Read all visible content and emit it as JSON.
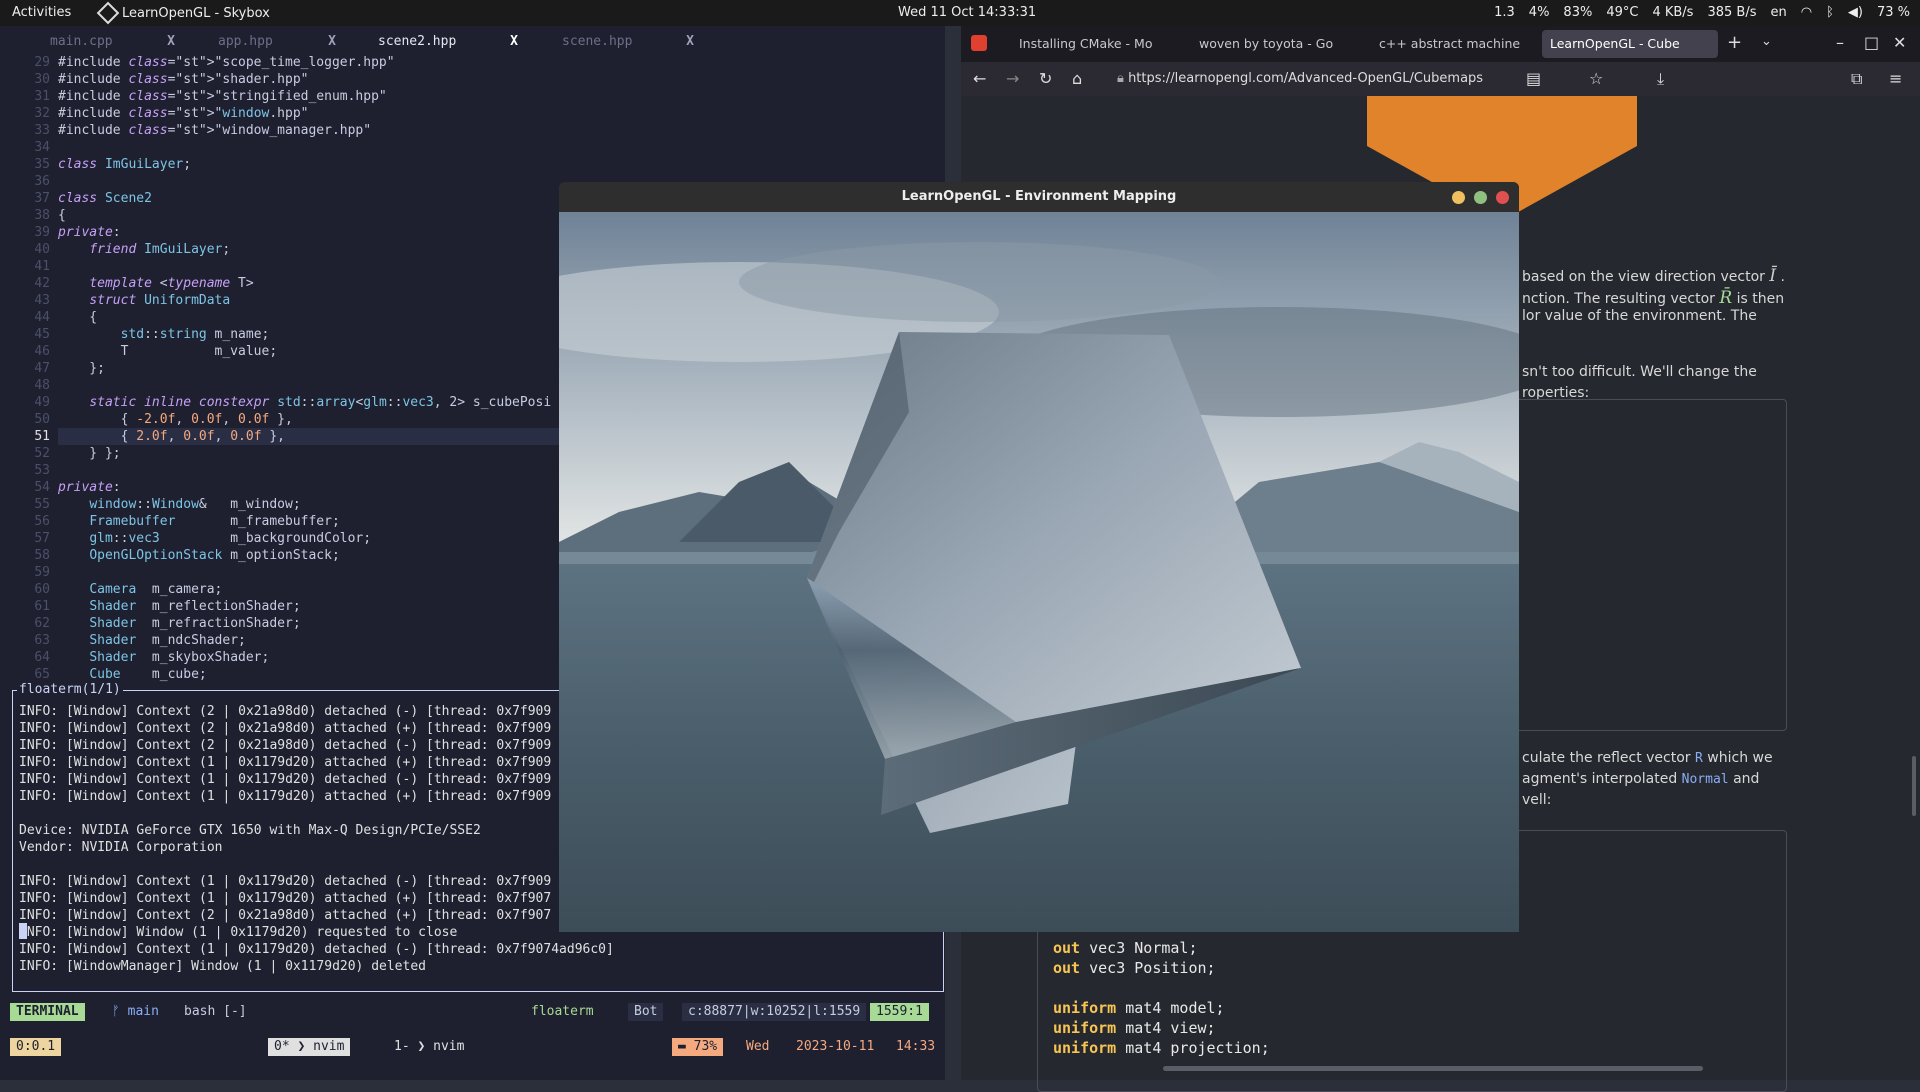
{
  "topbar": {
    "activities": "Activities",
    "window_title": "LearnOpenGL - Skybox",
    "clock": "Wed 11 Oct  14:33:31",
    "stats": [
      "1.3",
      "4%",
      "83%",
      "49°C",
      "4 KB/s",
      "385 B/s",
      "en",
      "73 %"
    ]
  },
  "editor": {
    "tabs": [
      {
        "label": "main.cpp",
        "close": "X"
      },
      {
        "label": "app.hpp",
        "close": "X"
      },
      {
        "label": "scene2.hpp",
        "close": "X"
      },
      {
        "label": "scene.hpp",
        "close": "X"
      }
    ],
    "lines": [
      {
        "n": "29",
        "t": "#include \"scope_time_logger.hpp\""
      },
      {
        "n": "30",
        "t": "#include \"shader.hpp\""
      },
      {
        "n": "31",
        "t": "#include \"stringified_enum.hpp\""
      },
      {
        "n": "32",
        "t": "#include \"window.hpp\""
      },
      {
        "n": "33",
        "t": "#include \"window_manager.hpp\""
      },
      {
        "n": "34",
        "t": ""
      },
      {
        "n": "35",
        "t": "class ImGuiLayer;"
      },
      {
        "n": "36",
        "t": ""
      },
      {
        "n": "37",
        "t": "class Scene2"
      },
      {
        "n": "38",
        "t": "{"
      },
      {
        "n": "39",
        "t": "private:"
      },
      {
        "n": "40",
        "t": "    friend ImGuiLayer;"
      },
      {
        "n": "41",
        "t": ""
      },
      {
        "n": "42",
        "t": "    template <typename T>"
      },
      {
        "n": "43",
        "t": "    struct UniformData"
      },
      {
        "n": "44",
        "t": "    {"
      },
      {
        "n": "45",
        "t": "        std::string m_name;"
      },
      {
        "n": "46",
        "t": "        T           m_value;"
      },
      {
        "n": "47",
        "t": "    };"
      },
      {
        "n": "48",
        "t": ""
      },
      {
        "n": "49",
        "t": "    static inline constexpr std::array<glm::vec3, 2> s_cubePosi"
      },
      {
        "n": "50",
        "t": "        { -2.0f, 0.0f, 0.0f },"
      },
      {
        "n": "51",
        "t": "        { 2.0f, 0.0f, 0.0f },"
      },
      {
        "n": "52",
        "t": "    } };"
      },
      {
        "n": "53",
        "t": ""
      },
      {
        "n": "54",
        "t": "private:"
      },
      {
        "n": "55",
        "t": "    window::Window&   m_window;"
      },
      {
        "n": "56",
        "t": "    Framebuffer       m_framebuffer;"
      },
      {
        "n": "57",
        "t": "    glm::vec3         m_backgroundColor;"
      },
      {
        "n": "58",
        "t": "    OpenGLOptionStack m_optionStack;"
      },
      {
        "n": "59",
        "t": ""
      },
      {
        "n": "60",
        "t": "    Camera  m_camera;"
      },
      {
        "n": "61",
        "t": "    Shader  m_reflectionShader;"
      },
      {
        "n": "62",
        "t": "    Shader  m_refractionShader;"
      },
      {
        "n": "63",
        "t": "    Shader  m_ndcShader;"
      },
      {
        "n": "64",
        "t": "    Shader  m_skyboxShader;"
      },
      {
        "n": "65",
        "t": "    Cube    m_cube;"
      }
    ],
    "floaterm_title": "floaterm(1/1)",
    "terminal": [
      "INFO: [Window] Context (2 | 0x21a98d0) detached (-) [thread: 0x7f909",
      "INFO: [Window] Context (2 | 0x21a98d0) attached (+) [thread: 0x7f909",
      "INFO: [Window] Context (2 | 0x21a98d0) detached (-) [thread: 0x7f909",
      "INFO: [Window] Context (1 | 0x1179d20) attached (+) [thread: 0x7f909",
      "INFO: [Window] Context (1 | 0x1179d20) detached (-) [thread: 0x7f909",
      "INFO: [Window] Context (1 | 0x1179d20) attached (+) [thread: 0x7f909",
      "",
      "Device: NVIDIA GeForce GTX 1650 with Max-Q Design/PCIe/SSE2",
      "Vendor: NVIDIA Corporation",
      "",
      "INFO: [Window] Context (1 | 0x1179d20) detached (-) [thread: 0x7f909",
      "INFO: [Window] Context (1 | 0x1179d20) attached (+) [thread: 0x7f907",
      "INFO: [Window] Context (2 | 0x21a98d0) attached (+) [thread: 0x7f907",
      "INFO: [Window] Window (1 | 0x1179d20) requested to close",
      "INFO: [Window] Context (1 | 0x1179d20) detached (-) [thread: 0x7f9074ad96c0]",
      "INFO: [WindowManager] Window (1 | 0x1179d20) deleted"
    ],
    "status1": {
      "mode": "TERMINAL",
      "branch": "main",
      "shell": "bash [-]",
      "plugin": "floaterm",
      "pos": "Bot",
      "info": "c:88877|w:10252|l:1559",
      "line": "1559:1"
    },
    "status2": {
      "session": "0:0.1",
      "win1": "0*",
      "win1_name": "nvim",
      "win2": "1-",
      "win2_name": "nvim",
      "battery": "73%",
      "day": "Wed",
      "date": "2023-10-11",
      "time": "14:33"
    }
  },
  "browser": {
    "tabs": [
      {
        "label": "Installing CMake - Mo"
      },
      {
        "label": "woven by toyota - Go"
      },
      {
        "label": "c++ abstract machine"
      },
      {
        "label": "LearnOpenGL - Cube"
      }
    ],
    "url": "https://learnopengl.com/Advanced-OpenGL/Cubemaps",
    "page_text": [
      "based on the view direction vector",
      "nction. The resulting vector",
      "is then",
      "lor value of the environment. The",
      "sn't too difficult. We'll change the",
      "roperties:",
      "culate the reflect vector",
      "which we",
      "agment's interpolated",
      "and",
      "vell:"
    ],
    "inline_code": {
      "r": "R",
      "normal": "Normal"
    },
    "math": {
      "i": "Ī",
      "r": "R̄"
    },
    "glsl": [
      {
        "kw": "out",
        "rest": " vec3 Normal;"
      },
      {
        "kw": "out",
        "rest": " vec3 Position;"
      },
      {
        "kw": "",
        "rest": ""
      },
      {
        "kw": "uniform",
        "rest": " mat4 model;"
      },
      {
        "kw": "uniform",
        "rest": " mat4 view;"
      },
      {
        "kw": "uniform",
        "rest": " mat4 projection;"
      }
    ]
  },
  "gl_window": {
    "title": "LearnOpenGL - Environment Mapping"
  },
  "colors": {
    "accent_green": "#a6da95",
    "accent_orange": "#e0832a",
    "status_blue": "#8aadf4"
  }
}
